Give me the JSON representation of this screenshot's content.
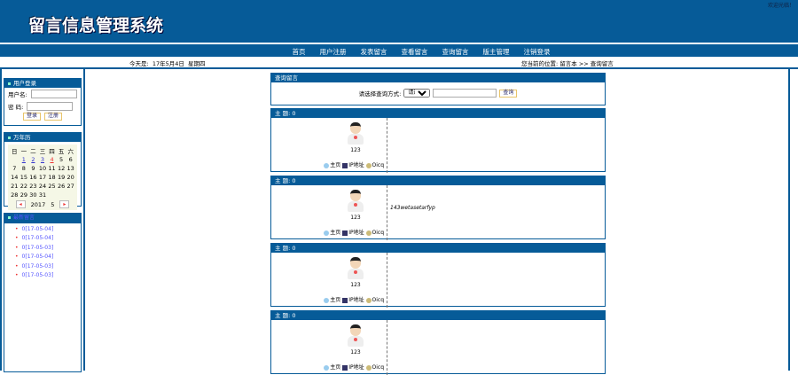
{
  "header": {
    "title": "留言信息管理系统",
    "welcome": "欢迎光临！"
  },
  "nav": [
    "首页",
    "用户注册",
    "发表留言",
    "查看留言",
    "查询留言",
    "版主管理",
    "注销登录"
  ],
  "date_info": {
    "label": "今天是:",
    "date": "17年5月4日",
    "weekday": "星期四"
  },
  "location": {
    "label": "您当前的位置:",
    "path": "留言本 >> 查询留言"
  },
  "login": {
    "title": "用户登录",
    "username_label": "用户名:",
    "password_label": "密 码:",
    "login_button": "登录",
    "register_button": "注册"
  },
  "calendar": {
    "title": "万年历",
    "weekdays": [
      "日",
      "一",
      "二",
      "三",
      "四",
      "五",
      "六"
    ],
    "weeks": [
      [
        "",
        "1",
        "2",
        "3",
        "4",
        "5",
        "6"
      ],
      [
        "7",
        "8",
        "9",
        "10",
        "11",
        "12",
        "13"
      ],
      [
        "14",
        "15",
        "16",
        "17",
        "18",
        "19",
        "20"
      ],
      [
        "21",
        "22",
        "23",
        "24",
        "25",
        "26",
        "27"
      ],
      [
        "28",
        "29",
        "30",
        "31",
        "",
        "",
        ""
      ]
    ],
    "year": "2017",
    "month": "5",
    "prev": "◂",
    "next": "▸"
  },
  "recent": {
    "title": "最新留言",
    "items": [
      "0[17-05-04]",
      "0[17-05-04]",
      "0[17-05-03]",
      "0[17-05-04]",
      "0[17-05-03]",
      "0[17-05-03]"
    ]
  },
  "search": {
    "title": "查询留言",
    "label": "请选择查询方式:",
    "select_value": "请选择",
    "button": "查询"
  },
  "entries": [
    {
      "subject_label": "主 题:",
      "subject": "0",
      "name": "123",
      "msg": "",
      "home": "主页",
      "ip": "IP地址",
      "qq": "Oicq"
    },
    {
      "subject_label": "主 题:",
      "subject": "0",
      "name": "123",
      "msg": "143wetasetarfyp",
      "home": "主页",
      "ip": "IP地址",
      "qq": "Oicq"
    },
    {
      "subject_label": "主 题:",
      "subject": "0",
      "name": "123",
      "msg": "",
      "home": "主页",
      "ip": "IP地址",
      "qq": "Oicq"
    },
    {
      "subject_label": "主 题:",
      "subject": "0",
      "name": "123",
      "msg": "",
      "home": "主页",
      "ip": "IP地址",
      "qq": "Oicq"
    }
  ]
}
